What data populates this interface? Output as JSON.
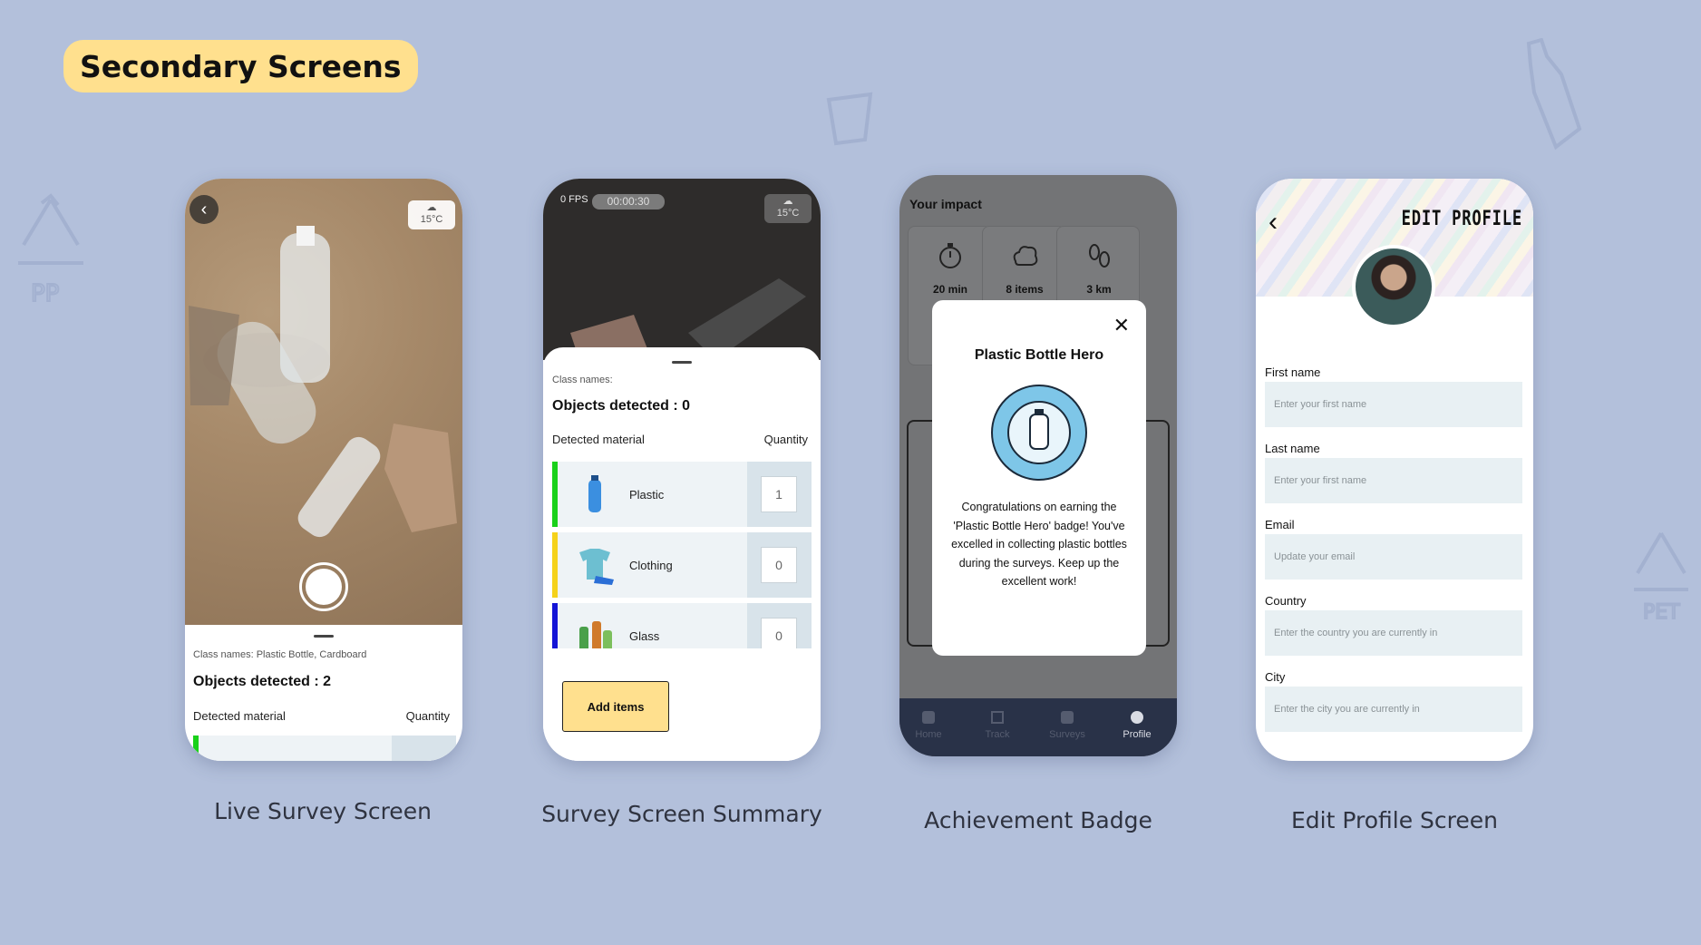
{
  "page": {
    "heading": "Secondary Screens"
  },
  "captions": [
    "Live Survey Screen",
    "Survey Screen Summary",
    "Achievement Badge",
    "Edit Profile Screen"
  ],
  "live_survey": {
    "back_glyph": "‹",
    "weather_temp": "15°C",
    "class_names": "Class names: Plastic Bottle, Cardboard",
    "objects_detected": "Objects detected : 2",
    "col_material": "Detected material",
    "col_quantity": "Quantity",
    "row_bar_color": "#19d11a"
  },
  "summary": {
    "fps": "0 FPS",
    "timer": "00:00:30",
    "weather_temp": "15°C",
    "class_names": "Class names:",
    "objects_detected": "Objects detected : 0",
    "col_material": "Detected material",
    "col_quantity": "Quantity",
    "rows": [
      {
        "name": "Plastic",
        "qty": "1",
        "color": "#19d11a",
        "icon": "plastic-bottle-icon"
      },
      {
        "name": "Clothing",
        "qty": "0",
        "color": "#f5d21a",
        "icon": "clothing-icon"
      },
      {
        "name": "Glass",
        "qty": "0",
        "color": "#1414d6",
        "icon": "glass-bottles-icon"
      }
    ],
    "add_items": "Add items"
  },
  "achievement": {
    "impact_title": "Your impact",
    "stats": [
      {
        "value": "20 min",
        "icon": "stopwatch-icon"
      },
      {
        "value": "8 items",
        "icon": "co2-cloud-icon"
      },
      {
        "value": "3 km",
        "icon": "footsteps-icon"
      }
    ],
    "modal_title": "Plastic Bottle Hero",
    "modal_text": "Congratulations on earning the 'Plastic Bottle Hero' badge! You've excelled in collecting plastic bottles during the surveys. Keep up the excellent work!",
    "close_glyph": "✕",
    "nav": [
      "Home",
      "Track",
      "Surveys",
      "Profile"
    ]
  },
  "profile": {
    "back_glyph": "‹",
    "title": "EDIT PROFILE",
    "fields": [
      {
        "label": "First name",
        "placeholder": "Enter your first name"
      },
      {
        "label": "Last name",
        "placeholder": "Enter your first name"
      },
      {
        "label": "Email",
        "placeholder": "Update your email"
      },
      {
        "label": "Country",
        "placeholder": "Enter the country you are currently in"
      },
      {
        "label": "City",
        "placeholder": "Enter the city you are currently in"
      }
    ]
  },
  "colors": {
    "background": "#b3c0db",
    "accent_yellow": "#ffe08e"
  }
}
